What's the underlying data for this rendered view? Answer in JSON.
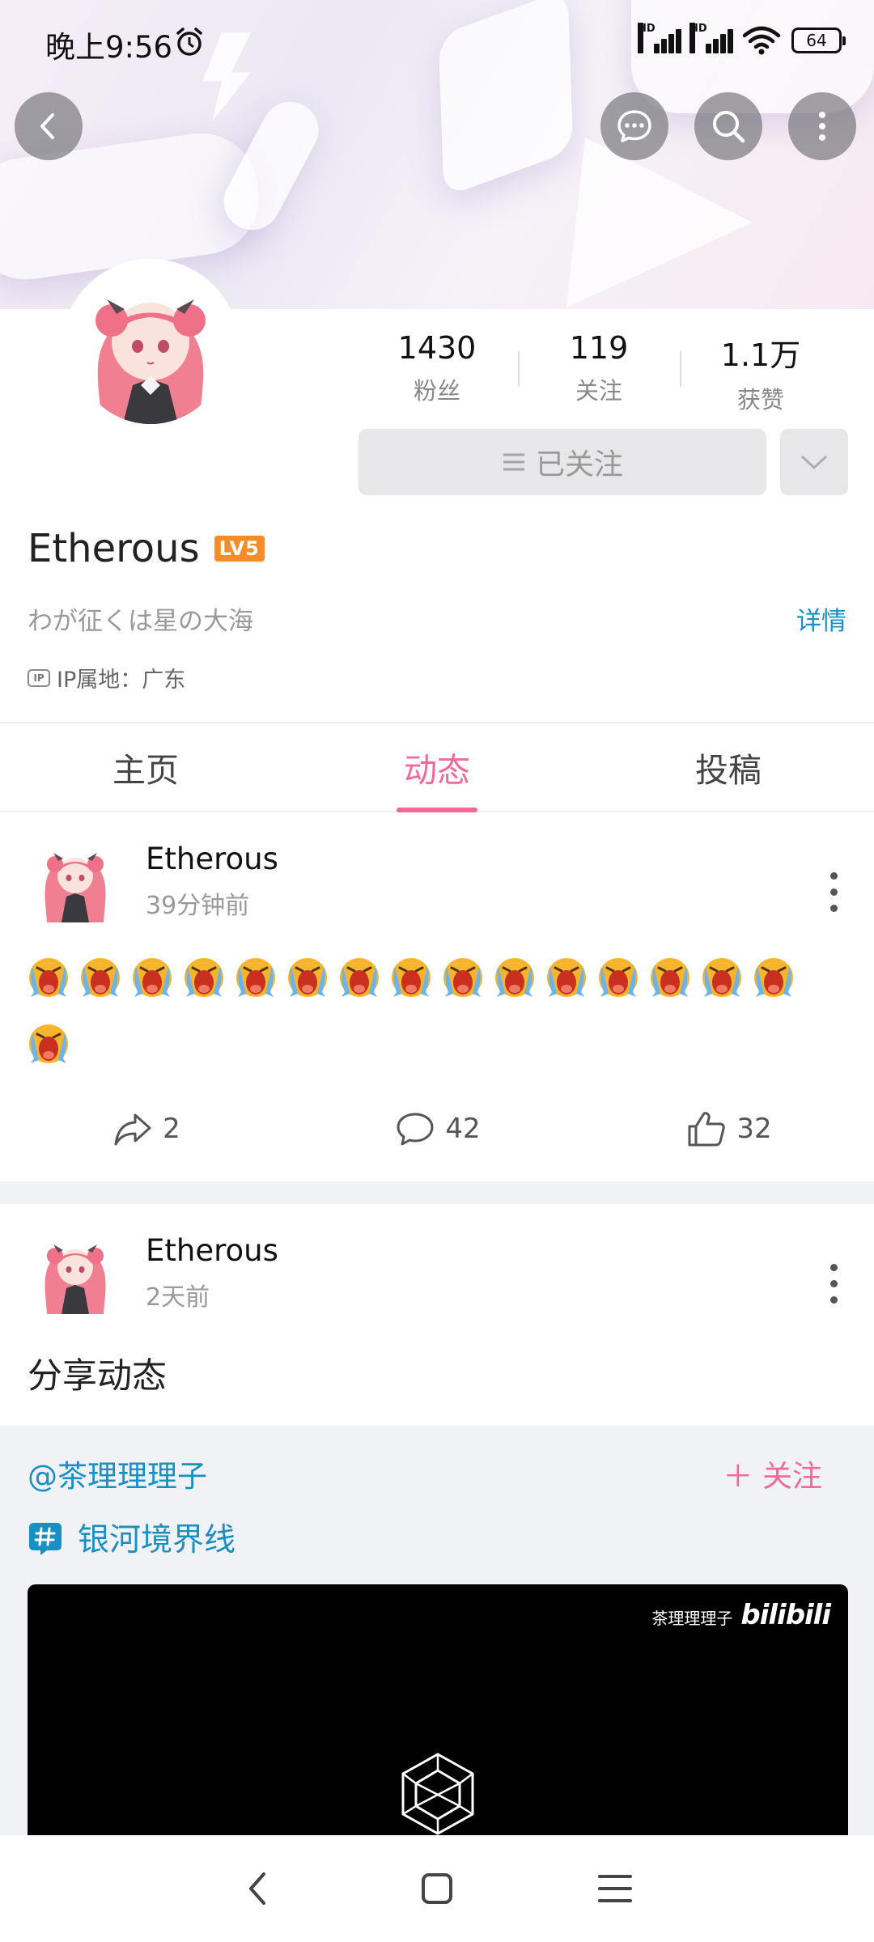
{
  "status_bar": {
    "time": "晚上9:56",
    "network_label": "HD",
    "battery": "64"
  },
  "header": {
    "icons": [
      "back-icon",
      "message-icon",
      "search-icon",
      "more-icon"
    ]
  },
  "profile": {
    "stats": [
      {
        "value": "1430",
        "label": "粉丝"
      },
      {
        "value": "119",
        "label": "关注"
      },
      {
        "value": "1.1万",
        "label": "获赞"
      }
    ],
    "follow_button": "已关注",
    "username": "Etherous",
    "level_badge": "LV5",
    "signature": "わが征くは星の大海",
    "detail_link": "详情",
    "ip_location": "IP属地：广东"
  },
  "tabs": [
    {
      "label": "主页",
      "active": false
    },
    {
      "label": "动态",
      "active": true
    },
    {
      "label": "投稿",
      "active": false
    }
  ],
  "posts": [
    {
      "author": "Etherous",
      "time": "39分钟前",
      "emoji": "cry-emoji",
      "emoji_count": 16,
      "actions": {
        "share": "2",
        "comment": "42",
        "like": "32"
      }
    },
    {
      "author": "Etherous",
      "time": "2天前",
      "text": "分享动态",
      "repost": {
        "user": "@茶理理理子",
        "follow": "关注",
        "topic": "银河境界线",
        "watermark_author": "茶理理理子",
        "watermark_logo": "bilibili"
      }
    }
  ],
  "colors": {
    "accent_pink": "#f26b98",
    "link_blue": "#1a8fc4",
    "level_orange": "#f58c2a"
  }
}
